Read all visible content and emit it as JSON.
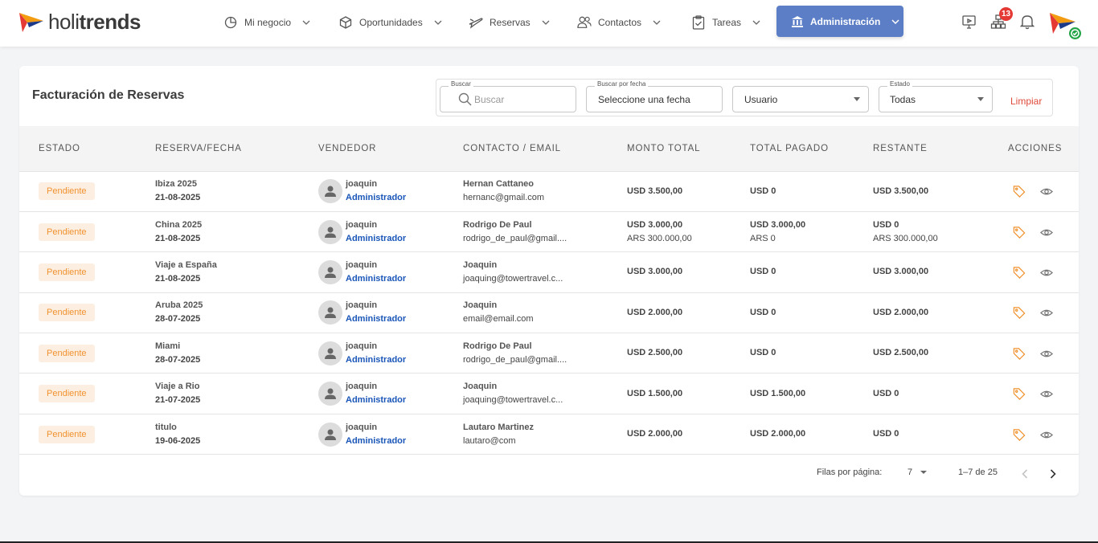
{
  "brand": {
    "part1": "holi",
    "part2": "trends"
  },
  "nav": {
    "items": [
      {
        "label": "Mi negocio",
        "icon": "pie-chart-icon"
      },
      {
        "label": "Oportunidades",
        "icon": "cube-icon"
      },
      {
        "label": "Reservas",
        "icon": "plane-icon"
      },
      {
        "label": "Contactos",
        "icon": "users-icon"
      },
      {
        "label": "Tareas",
        "icon": "clipboard-check-icon"
      }
    ],
    "active": {
      "label": "Administración",
      "icon": "bank-icon"
    },
    "notifications_count": "13"
  },
  "page": {
    "title": "Facturación de Reservas"
  },
  "filters": {
    "search": {
      "label": "Buscar",
      "placeholder": "Buscar"
    },
    "date": {
      "label": "Buscar por fecha",
      "value": "Seleccione una fecha"
    },
    "user": {
      "value": "Usuario"
    },
    "status": {
      "label": "Estado",
      "value": "Todas"
    },
    "clear_label": "Limpiar"
  },
  "table": {
    "headers": [
      "ESTADO",
      "RESERVA/FECHA",
      "VENDEDOR",
      "CONTACTO / EMAIL",
      "MONTO TOTAL",
      "TOTAL PAGADO",
      "RESTANTE",
      "ACCIONES"
    ],
    "rows": [
      {
        "status": "Pendiente",
        "reserva": "Ibiza 2025",
        "fecha": "21-08-2025",
        "vendor": "joaquin",
        "role": "Administrador",
        "contact": "Hernan Cattaneo",
        "email": "hernanc@gmail.com",
        "monto": "USD 3.500,00",
        "monto2": "",
        "pagado": "USD 0",
        "pagado2": "",
        "restante": "USD 3.500,00",
        "restante2": ""
      },
      {
        "status": "Pendiente",
        "reserva": "China 2025",
        "fecha": "21-08-2025",
        "vendor": "joaquin",
        "role": "Administrador",
        "contact": "Rodrigo De Paul",
        "email": "rodrigo_de_paul@gmail....",
        "monto": "USD 3.000,00",
        "monto2": "ARS 300.000,00",
        "pagado": "USD 3.000,00",
        "pagado2": "ARS 0",
        "restante": "USD 0",
        "restante2": "ARS 300.000,00"
      },
      {
        "status": "Pendiente",
        "reserva": "Viaje a España",
        "fecha": "21-08-2025",
        "vendor": "joaquin",
        "role": "Administrador",
        "contact": "Joaquin",
        "email": "joaquing@towertravel.c...",
        "monto": "USD 3.000,00",
        "monto2": "",
        "pagado": "USD 0",
        "pagado2": "",
        "restante": "USD 3.000,00",
        "restante2": ""
      },
      {
        "status": "Pendiente",
        "reserva": "Aruba 2025",
        "fecha": "28-07-2025",
        "vendor": "joaquin",
        "role": "Administrador",
        "contact": "Joaquin",
        "email": "email@email.com",
        "monto": "USD 2.000,00",
        "monto2": "",
        "pagado": "USD 0",
        "pagado2": "",
        "restante": "USD 2.000,00",
        "restante2": ""
      },
      {
        "status": "Pendiente",
        "reserva": "Miami",
        "fecha": "28-07-2025",
        "vendor": "joaquin",
        "role": "Administrador",
        "contact": "Rodrigo De Paul",
        "email": "rodrigo_de_paul@gmail....",
        "monto": "USD 2.500,00",
        "monto2": "",
        "pagado": "USD 0",
        "pagado2": "",
        "restante": "USD 2.500,00",
        "restante2": ""
      },
      {
        "status": "Pendiente",
        "reserva": "Viaje a Rio",
        "fecha": "21-07-2025",
        "vendor": "joaquin",
        "role": "Administrador",
        "contact": "Joaquin",
        "email": "joaquing@towertravel.c...",
        "monto": "USD 1.500,00",
        "monto2": "",
        "pagado": "USD 1.500,00",
        "pagado2": "",
        "restante": "USD 0",
        "restante2": ""
      },
      {
        "status": "Pendiente",
        "reserva": "titulo",
        "fecha": "19-06-2025",
        "vendor": "joaquin",
        "role": "Administrador",
        "contact": "Lautaro Martinez",
        "email": "lautaro@com",
        "monto": "USD 2.000,00",
        "monto2": "",
        "pagado": "USD 2.000,00",
        "pagado2": "",
        "restante": "USD 0",
        "restante2": ""
      }
    ]
  },
  "pagination": {
    "rows_label": "Filas por página:",
    "rows_value": "7",
    "range": "1–7 de 25"
  },
  "colors": {
    "accent": "#5b7ec7",
    "pending_bg": "#fdeee2",
    "pending_text": "#f0922e",
    "role_blue": "#1a56b8",
    "clear_red": "#e04a3a",
    "badge": "#e53935"
  }
}
